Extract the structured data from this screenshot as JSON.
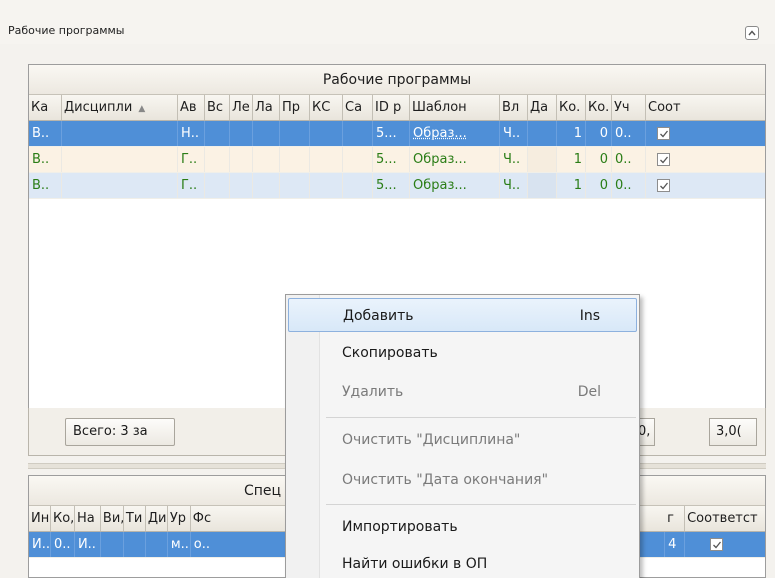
{
  "panel": {
    "title": "Рабочие программы",
    "collapse_icon": "chevron-up-icon"
  },
  "grid1": {
    "caption": "Рабочие программы",
    "columns": [
      "Ка",
      "Дисципли",
      "Ав",
      "Вс",
      "Ле",
      "Ла",
      "Пр",
      "КС",
      "Са",
      "ID р",
      "Шаблон",
      "Вл",
      "Да",
      "Ко.",
      "Ко.",
      "Уч",
      "Соот"
    ],
    "sort_indicator": "▲",
    "rows": [
      {
        "c0": "В..",
        "c1": "",
        "c2": "Н..",
        "c9": "5...",
        "c10": "Образ...",
        "c11": "Ч..",
        "c13": "1",
        "c14": "0",
        "c15": "0..",
        "checked": true
      },
      {
        "c0": "В..",
        "c1": "",
        "c2": "Г..",
        "c9": "5...",
        "c10": "Образ...",
        "c11": "Ч..",
        "c13": "1",
        "c14": "0",
        "c15": "0..",
        "checked": true
      },
      {
        "c0": "В..",
        "c1": "",
        "c2": "Г..",
        "c9": "5...",
        "c10": "Образ...",
        "c11": "Ч..",
        "c13": "1",
        "c14": "0",
        "c15": "0..",
        "checked": true
      }
    ]
  },
  "footer": {
    "total": "Всего: 3 за",
    "box1": "0,",
    "box2": "3,0("
  },
  "grid2": {
    "caption": "Спец",
    "columns_left": [
      "Ин",
      "Ко,",
      "На",
      "Ви,",
      "Ти",
      "Ди",
      "Ур",
      "Фс"
    ],
    "columns_right": [
      "г",
      "Соответст"
    ],
    "row": {
      "c0": "И..",
      "c1": "0..",
      "c2": "И..",
      "c6": "м..",
      "c7": "о..",
      "right": "4",
      "checked": true
    }
  },
  "context_menu": {
    "items": [
      {
        "label": "Добавить",
        "shortcut": "Ins",
        "state": "hover"
      },
      {
        "label": "Скопировать",
        "shortcut": "",
        "state": "normal"
      },
      {
        "label": "Удалить",
        "shortcut": "Del",
        "state": "disabled"
      },
      {
        "label": "Очистить \"Дисциплина\"",
        "shortcut": "",
        "state": "disabled"
      },
      {
        "label": "Очистить \"Дата окончания\"",
        "shortcut": "",
        "state": "disabled"
      },
      {
        "label": "Импортировать",
        "shortcut": "",
        "state": "normal"
      },
      {
        "label": "Найти ошибки в ОП",
        "shortcut": "",
        "state": "normal"
      }
    ]
  },
  "colors": {
    "selection": "#4f8fd7",
    "row_green_text": "#2a7d16",
    "row_alt_a": "#fbf2e4",
    "row_alt_b": "#dde8f5"
  }
}
